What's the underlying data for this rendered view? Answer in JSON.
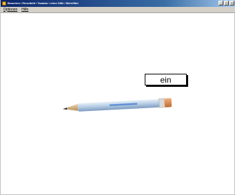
{
  "window": {
    "title": "Bewerten / Einzelbild / Tastatur / ohne Hilfe / Mehrfilter"
  },
  "menu": {
    "items": [
      "Optionen",
      "Hilfe"
    ]
  },
  "card": {
    "word": "ein"
  },
  "icons": {
    "app": "app-icon",
    "minimize": "minimize-icon",
    "maximize": "maximize-icon",
    "close": "close-icon",
    "pencil": "pencil-image"
  }
}
